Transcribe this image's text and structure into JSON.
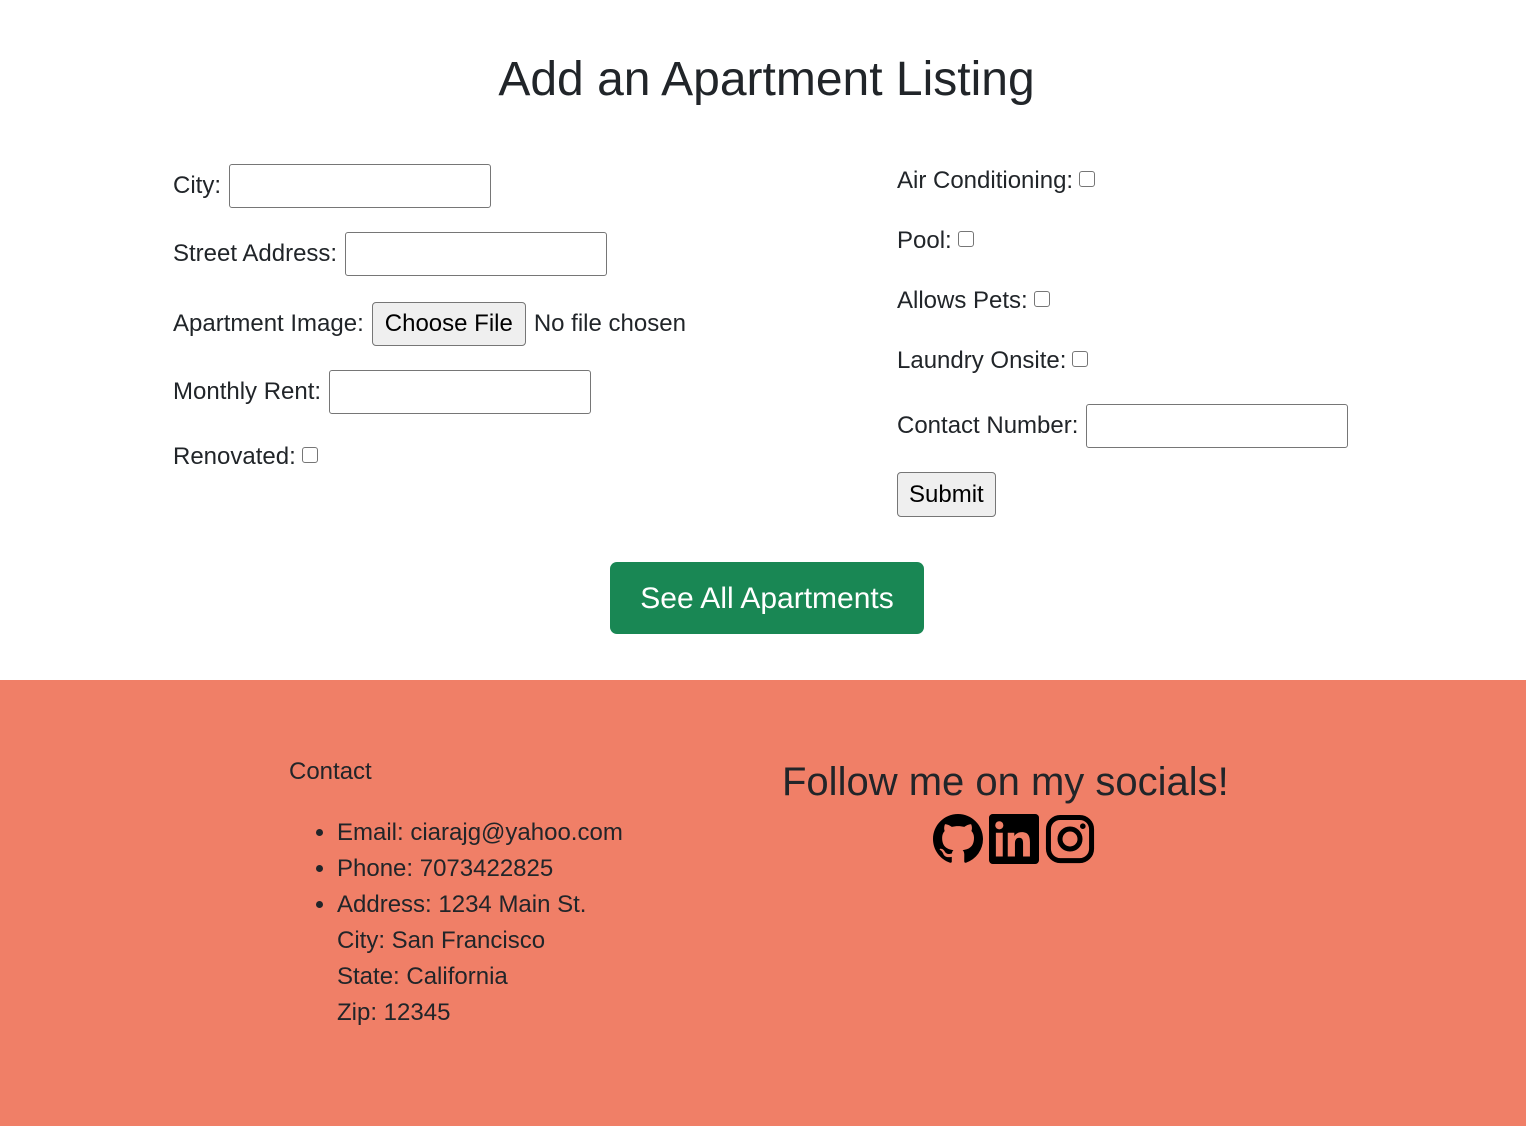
{
  "page": {
    "title": "Add an Apartment Listing"
  },
  "form": {
    "city_label": "City:",
    "city_value": "",
    "street_label": "Street Address:",
    "street_value": "",
    "image_label": "Apartment Image:",
    "choose_file_label": "Choose File",
    "file_status": "No file chosen",
    "rent_label": "Monthly Rent:",
    "rent_value": "",
    "renovated_label": "Renovated:",
    "ac_label": "Air Conditioning:",
    "pool_label": "Pool:",
    "pets_label": "Allows Pets:",
    "laundry_label": "Laundry Onsite:",
    "contact_label": "Contact Number:",
    "contact_value": "",
    "submit_label": "Submit"
  },
  "see_all_label": "See All Apartments",
  "footer": {
    "background": "#f07f67",
    "contact_heading": "Contact",
    "email": "Email: ciarajg@yahoo.com",
    "phone": "Phone: 7073422825",
    "address": "Address: 1234 Main St.",
    "city": "City: San Francisco",
    "state": "State: California",
    "zip": "Zip: 12345",
    "socials_heading": "Follow me on my socials!",
    "icons": [
      "github-icon",
      "linkedin-icon",
      "instagram-icon"
    ]
  },
  "colors": {
    "accent_green": "#198754",
    "text": "#212529"
  }
}
